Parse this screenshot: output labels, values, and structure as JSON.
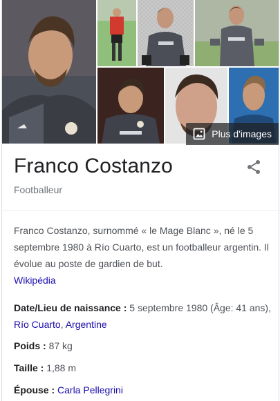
{
  "images": {
    "more_images_label": "Plus d'images"
  },
  "entity": {
    "name": "Franco Costanzo",
    "type": "Footballeur"
  },
  "description": {
    "text": "Franco Costanzo, surnommé « le Mage Blanc », né le 5 septembre 1980 à Río Cuarto, est un footballeur argentin. Il évolue au poste de gardien de but.",
    "source_link": "Wikipédia"
  },
  "facts": {
    "birth": {
      "label": "Date/Lieu de naissance :",
      "value": "5 septembre 1980 (Âge: 41 ans),",
      "place_city": "Río Cuarto",
      "place_sep": ",",
      "place_country": "Argentine"
    },
    "weight": {
      "label": "Poids :",
      "value": "87 kg"
    },
    "height": {
      "label": "Taille :",
      "value": "1,88 m"
    },
    "spouse": {
      "label": "Épouse :",
      "value": "Carla Pellegrini"
    }
  },
  "colors": {
    "link": "#1a0dab",
    "text": "#4d5156",
    "title": "#202124",
    "muted": "#70757a"
  }
}
